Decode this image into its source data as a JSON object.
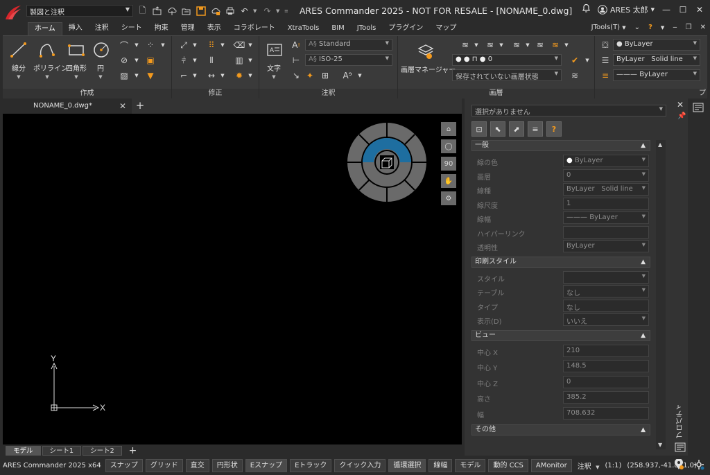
{
  "titlebar": {
    "workspace": "製図と注釈",
    "title": "ARES Commander 2025 - NOT FOR RESALE - [NONAME_0.dwg]",
    "user": "ARES 太郎"
  },
  "ribbon_tabs": [
    "ホーム",
    "挿入",
    "注釈",
    "シート",
    "拘束",
    "管理",
    "表示",
    "コラボレート",
    "XtraTools",
    "BIM",
    "JTools",
    "プラグイン",
    "マップ"
  ],
  "ribbon_tabs_right": {
    "jtools": "JTools(T)",
    "help": "?"
  },
  "ribbon": {
    "create": {
      "title": "作成",
      "line": "線分",
      "polyline": "ポリライン",
      "rectangle": "四角形",
      "circle": "円"
    },
    "modify": {
      "title": "修正"
    },
    "annotation": {
      "title": "注釈",
      "text": "文字",
      "text_style": "Standard",
      "dim_style": "ISO-25"
    },
    "layers": {
      "title": "画層",
      "manager": "画層マネージャー",
      "layer_value": "0",
      "state_placeholder": "保存されていない画層状態"
    },
    "properties": {
      "color": "ByLayer",
      "linetype": "ByLayer",
      "linetype_name": "Solid line",
      "lineweight": "ByLayer",
      "title_partial": "プ"
    }
  },
  "doc_tab": {
    "name": "NONAME_0.dwg*"
  },
  "navbar": {
    "zoom_label": "90"
  },
  "ucs": {
    "x": "X",
    "y": "Y"
  },
  "layout_tabs": [
    "モデル",
    "シート1",
    "シート2"
  ],
  "properties_panel": {
    "selection": "選択がありません",
    "general": {
      "title": "一般",
      "rows": [
        {
          "label": "線の色",
          "value": "ByLayer"
        },
        {
          "label": "画層",
          "value": "0"
        },
        {
          "label": "線種",
          "value": "ByLayer",
          "value2": "Solid line"
        },
        {
          "label": "線尺度",
          "value": "1"
        },
        {
          "label": "線幅",
          "value": "ByLayer"
        },
        {
          "label": "ハイパーリンク",
          "value": ""
        },
        {
          "label": "透明性",
          "value": "ByLayer"
        }
      ]
    },
    "print_style": {
      "title": "印刷スタイル",
      "rows": [
        {
          "label": "スタイル",
          "value": ""
        },
        {
          "label": "テーブル",
          "value": "なし"
        },
        {
          "label": "タイプ",
          "value": "なし"
        },
        {
          "label": "表示(D)",
          "value": "いいえ"
        }
      ]
    },
    "view": {
      "title": "ビュー",
      "rows": [
        {
          "label": "中心 X",
          "value": "210"
        },
        {
          "label": "中心 Y",
          "value": "148.5"
        },
        {
          "label": "中心 Z",
          "value": "0"
        },
        {
          "label": "高さ",
          "value": "385.2"
        },
        {
          "label": "幅",
          "value": "708.632"
        }
      ]
    },
    "other": {
      "title": "その他"
    },
    "dock_label": "プロパティ"
  },
  "statusbar": {
    "app": "ARES Commander 2025 x64",
    "buttons": [
      "スナップ",
      "グリッド",
      "直交",
      "円形状",
      "Eスナップ",
      "Eトラック",
      "クイック入力",
      "循環選択",
      "線幅",
      "モデル",
      "動的 CCS",
      "AMonitor"
    ],
    "annotation": "注釈",
    "scale": "(1:1)",
    "coords": "(258.937,-41.811,0)"
  },
  "colors": {
    "accent_orange": "#f39a1e",
    "viewcube_blue": "#1e6ea0",
    "canvas": "#000000"
  }
}
